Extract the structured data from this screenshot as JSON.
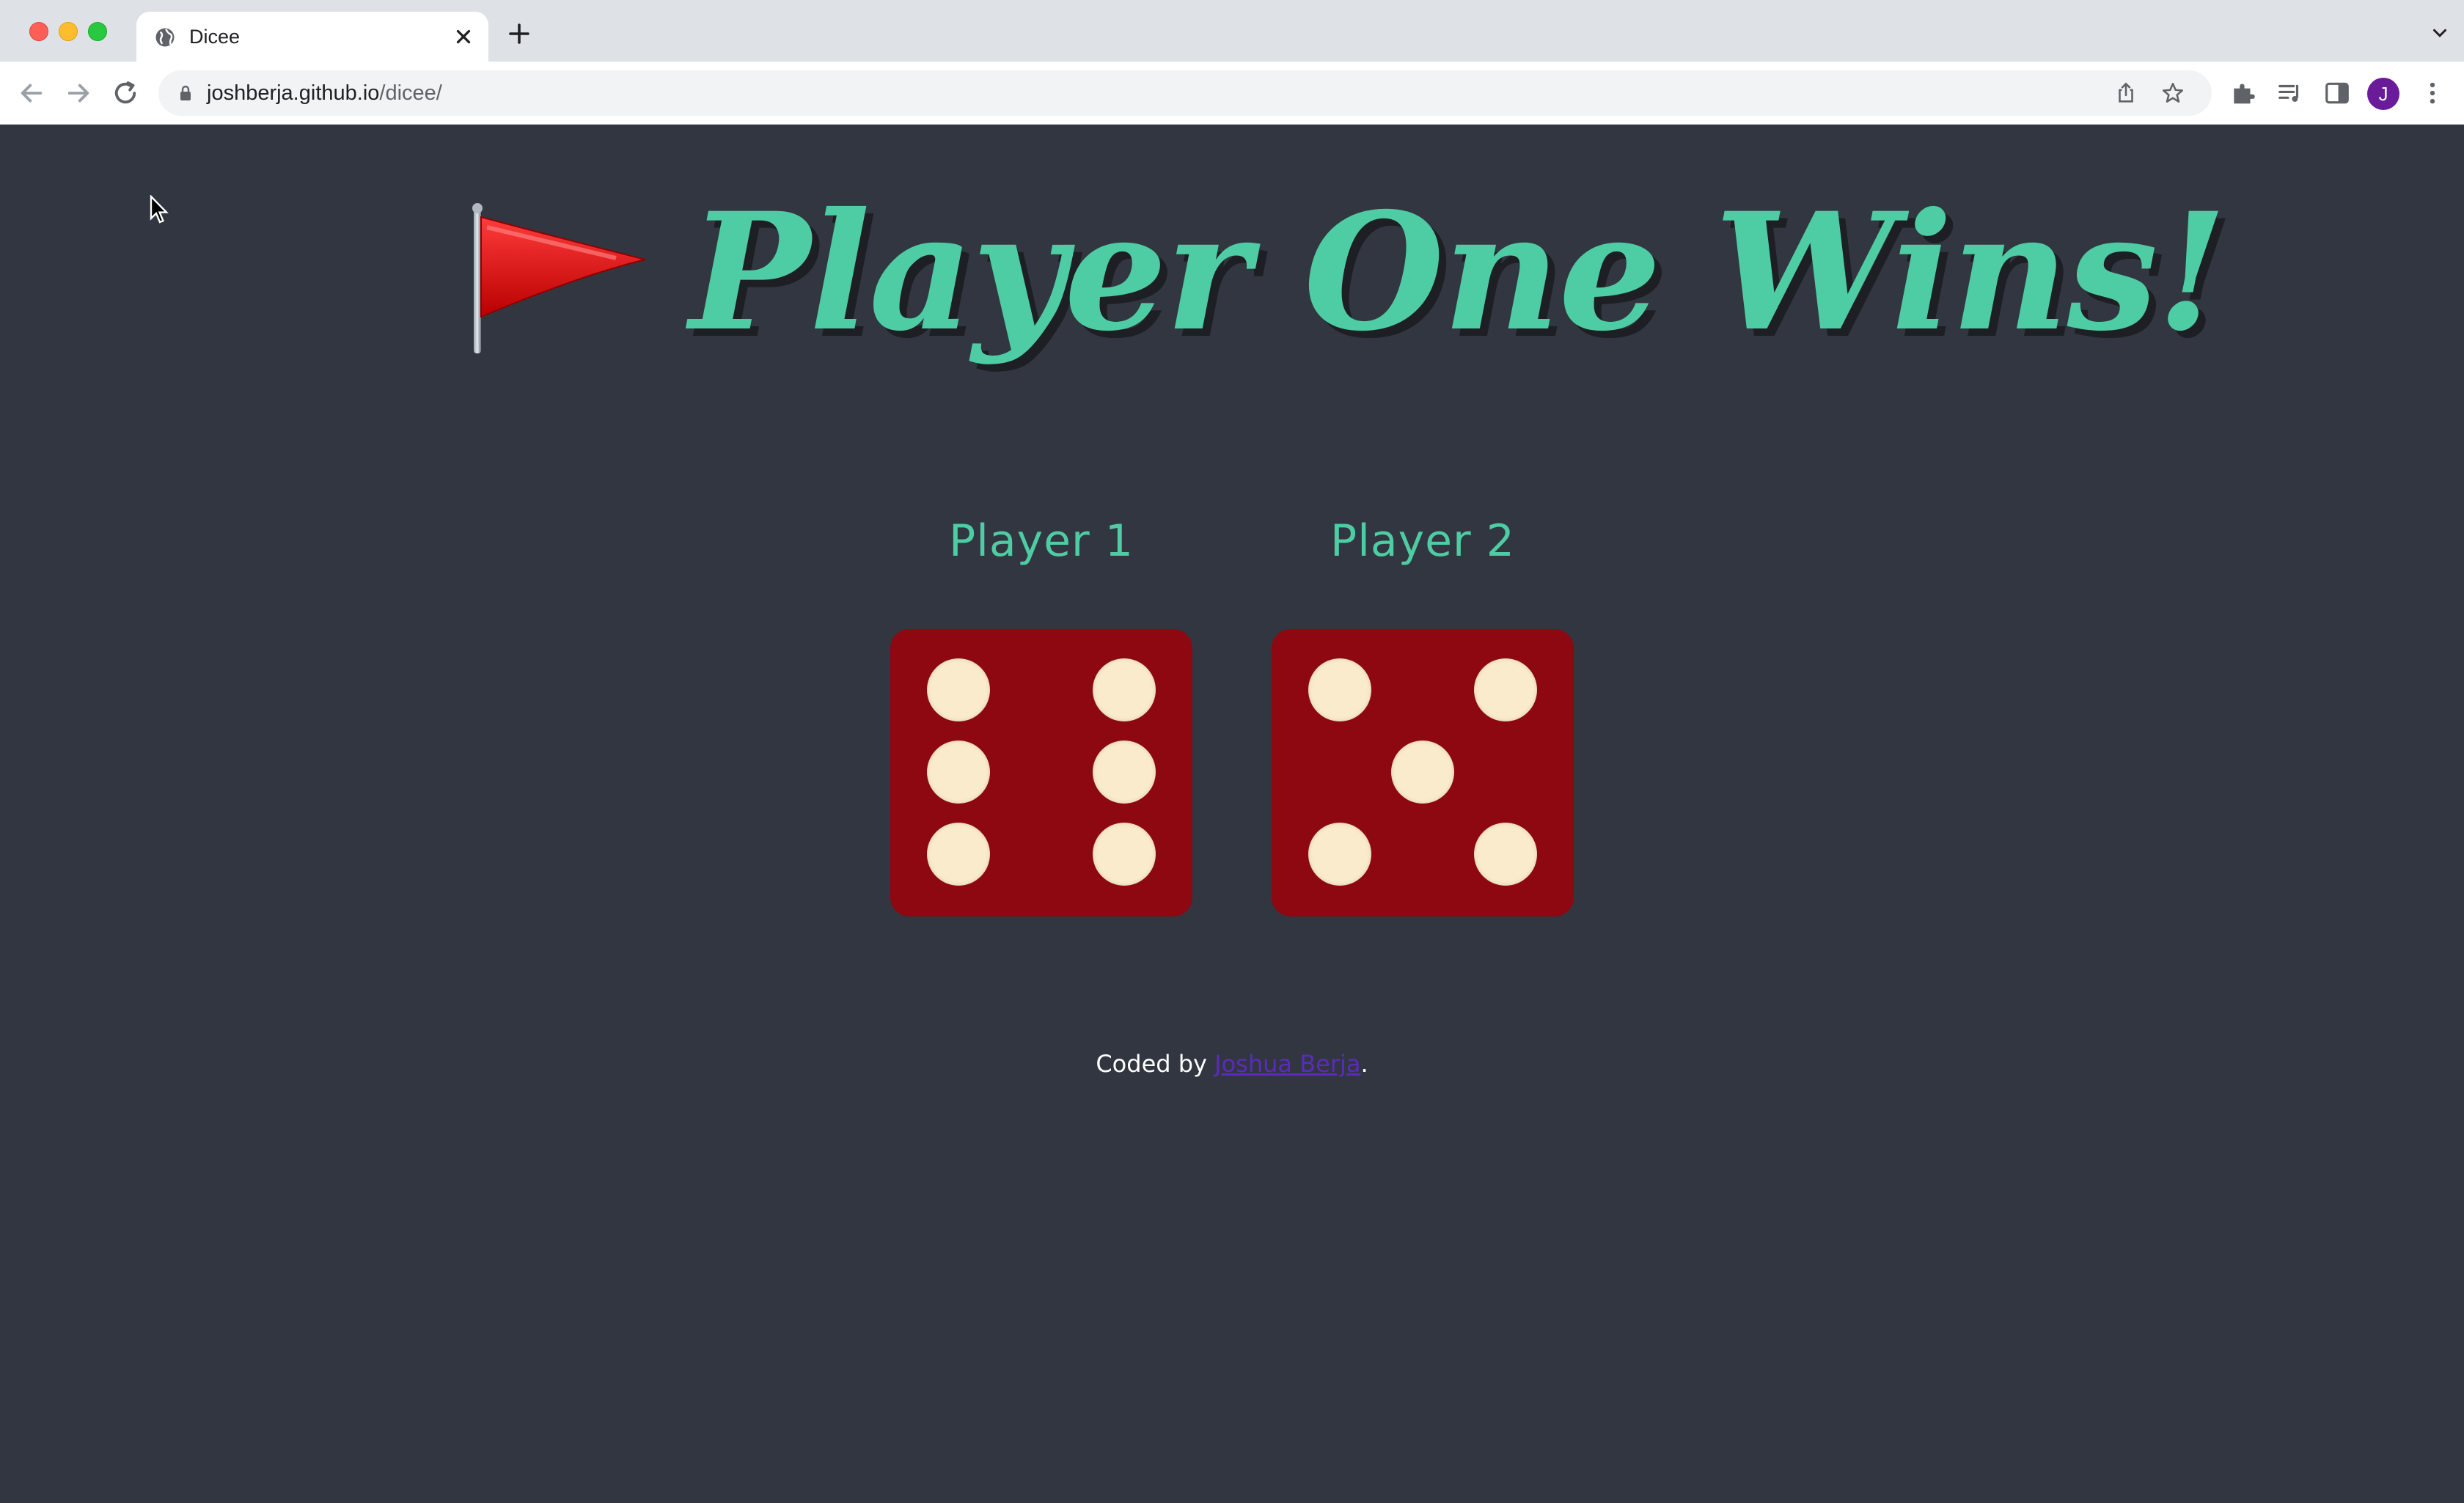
{
  "browser": {
    "tab_title": "Dicee",
    "url_host": "joshberja.github.io",
    "url_path": "/dicee/",
    "profile_initial": "J",
    "icons": [
      "globe-icon",
      "close-icon",
      "plus-icon",
      "chevron-down-icon",
      "back-arrow-icon",
      "forward-arrow-icon",
      "reload-icon",
      "lock-icon",
      "share-icon",
      "star-icon",
      "puzzle-icon",
      "media-icon",
      "side-panel-icon",
      "kebab-menu-icon"
    ]
  },
  "page": {
    "title": "Player One Wins!",
    "title_icon": "red-flag-icon",
    "players": [
      {
        "label": "Player 1",
        "die_value": 6
      },
      {
        "label": "Player 2",
        "die_value": 5
      }
    ],
    "footer": {
      "prefix": "Coded by ",
      "link_text": "Joshua Berja",
      "suffix": "."
    }
  },
  "colors": {
    "background": "#323640",
    "accent": "#4ecca3",
    "die": "#8d0810",
    "pip": "#fbebcd"
  }
}
